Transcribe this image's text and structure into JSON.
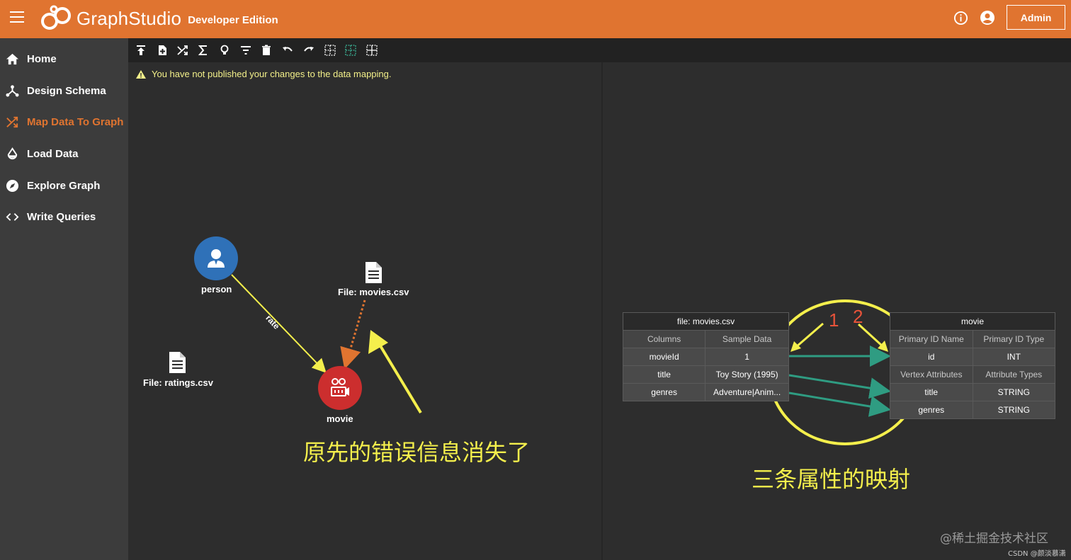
{
  "header": {
    "brand": "GraphStudio",
    "edition": "Developer Edition",
    "admin_label": "Admin",
    "accent": "#e07430"
  },
  "sidebar": {
    "items": [
      {
        "label": "Home",
        "icon": "home-icon"
      },
      {
        "label": "Design Schema",
        "icon": "schema-icon"
      },
      {
        "label": "Map Data To Graph",
        "icon": "shuffle-icon",
        "active": true
      },
      {
        "label": "Load Data",
        "icon": "drop-icon"
      },
      {
        "label": "Explore Graph",
        "icon": "compass-icon"
      },
      {
        "label": "Write Queries",
        "icon": "code-icon"
      }
    ]
  },
  "toolbar": {
    "tools": [
      "publish-icon",
      "add-file-icon",
      "map-icon",
      "sum-icon",
      "bulb-icon",
      "filter-icon",
      "delete-icon",
      "undo-icon",
      "redo-icon",
      "grid-icon",
      "grid-select-icon",
      "grid-alt-icon"
    ]
  },
  "warning": {
    "text": "You have not published your changes to the data mapping."
  },
  "graph": {
    "vertex_person": "person",
    "vertex_movie": "movie",
    "edge_rate": "rate",
    "file_movies": "File: movies.csv",
    "file_ratings": "File: ratings.csv"
  },
  "annotations": {
    "left_caption": "原先的错误信息消失了",
    "right_caption": "三条属性的映射",
    "num_1": "1",
    "num_2": "2"
  },
  "file_table": {
    "title": "file: movies.csv",
    "headers": [
      "Columns",
      "Sample Data"
    ],
    "rows": [
      [
        "movieId",
        "1"
      ],
      [
        "title",
        "Toy Story (1995)"
      ],
      [
        "genres",
        "Adventure|Anim..."
      ]
    ]
  },
  "vertex_table": {
    "title": "movie",
    "id_headers": [
      "Primary ID Name",
      "Primary ID Type"
    ],
    "id_row": [
      "id",
      "INT"
    ],
    "attr_headers": [
      "Vertex Attributes",
      "Attribute Types"
    ],
    "attr_rows": [
      [
        "title",
        "STRING"
      ],
      [
        "genres",
        "STRING"
      ]
    ]
  },
  "watermark": {
    "line1": "@稀土掘金技术社区",
    "line2": "CSDN @颜淡慕潇"
  }
}
